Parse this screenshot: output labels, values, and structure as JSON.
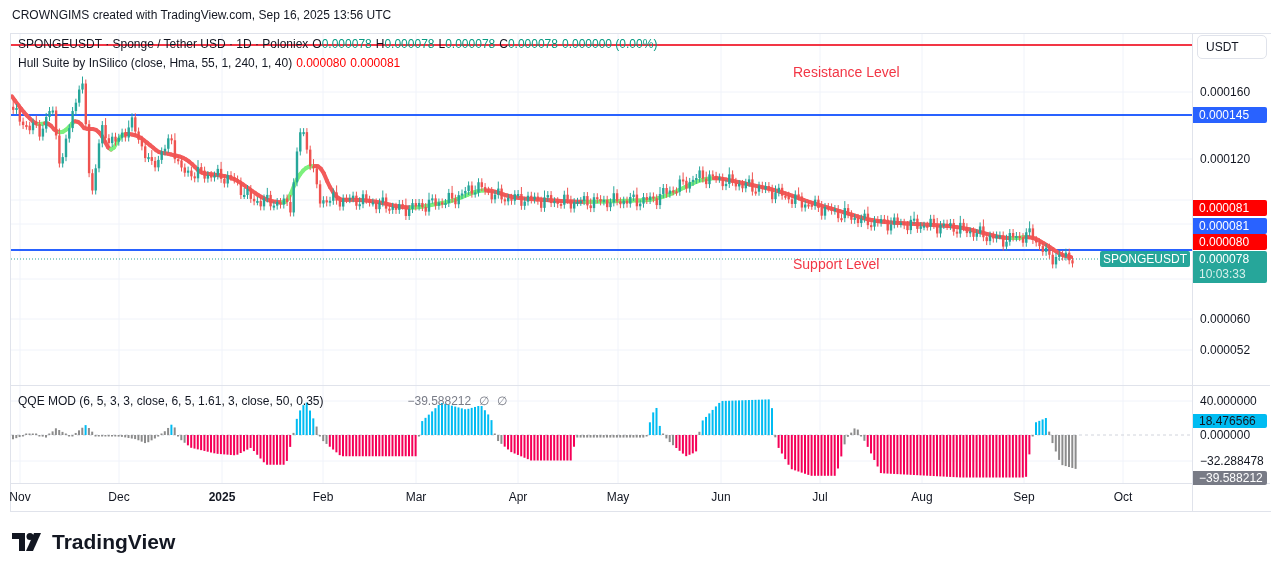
{
  "attribution": "CROWNGIMS created with TradingView.com, Sep 16, 2025 13:56 UTC",
  "legend": {
    "title": "SPONGEUSDT · Sponge / Tether USD · 1D · Poloniex",
    "ohlc": [
      {
        "key": "O",
        "value": "0.000078"
      },
      {
        "key": "H",
        "value": "0.000078"
      },
      {
        "key": "L",
        "value": "0.000078"
      },
      {
        "key": "C",
        "value": "0.000078"
      }
    ],
    "change": "0.000000 (0.00%)"
  },
  "indicator": {
    "name": "Hull Suite by InSilico (close, Hma, 55, 1, 240, 1, 40)",
    "values": [
      "0.000080",
      "0.000081"
    ]
  },
  "annotations": [
    "Resistance Level",
    "Support Level"
  ],
  "price_axis": {
    "unit": "USDT",
    "ticks": [
      "0.000160",
      "0.000120",
      "0.000060",
      "0.000052"
    ],
    "labels": [
      {
        "text": "0.000145",
        "color": "#2962ff"
      },
      {
        "text": "0.000081",
        "color": "#ff0000"
      },
      {
        "text": "0.000081",
        "color": "#2962ff"
      },
      {
        "text": "0.000080",
        "color": "#ff0000"
      }
    ],
    "symbol_tag": "SPONGEUSDT",
    "last_price": {
      "text": "0.000078",
      "countdown": "10:03:33",
      "color": "#26a69a"
    }
  },
  "oscillator": {
    "name": "QQE MOD (6, 5, 3, 3, close, 6, 5, 1.61, 3, close, 50, 0.35)",
    "values": [
      "−39.588212",
      "∅",
      "∅"
    ],
    "axis": {
      "ticks": [
        "40.000000",
        "0.000000",
        "−32.288478"
      ],
      "labels": [
        {
          "text": "18.476566",
          "color": "#00bcf2"
        },
        {
          "text": "−39.588212",
          "color": "#787b86"
        }
      ]
    }
  },
  "time_axis": [
    {
      "label": "Nov",
      "kind": "month"
    },
    {
      "label": "Dec",
      "kind": "month"
    },
    {
      "label": "2025",
      "kind": "year"
    },
    {
      "label": "Feb",
      "kind": "month"
    },
    {
      "label": "Mar",
      "kind": "month"
    },
    {
      "label": "Apr",
      "kind": "month"
    },
    {
      "label": "May",
      "kind": "month"
    },
    {
      "label": "Jun",
      "kind": "month"
    },
    {
      "label": "Jul",
      "kind": "month"
    },
    {
      "label": "Aug",
      "kind": "month"
    },
    {
      "label": "Sep",
      "kind": "month"
    },
    {
      "label": "Oct",
      "kind": "month"
    }
  ],
  "logo": "TradingView"
}
